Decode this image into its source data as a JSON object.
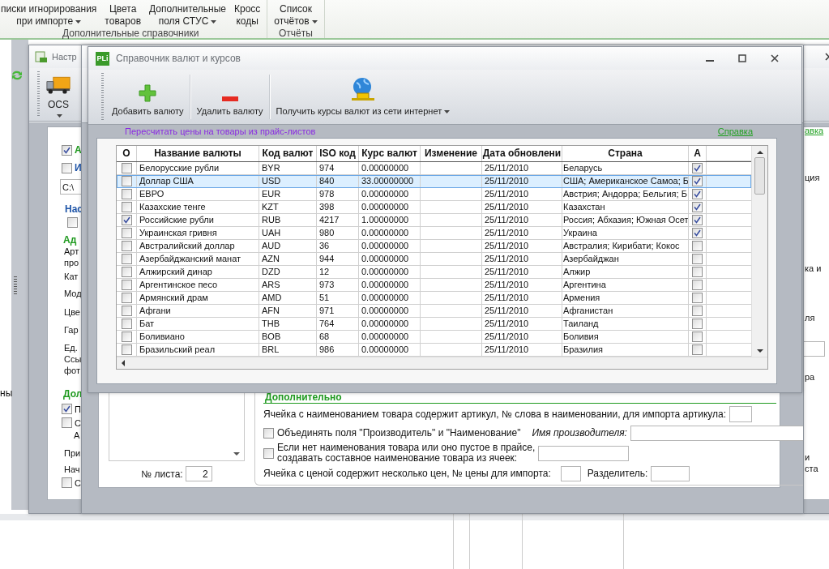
{
  "ribbon": {
    "groups": [
      {
        "label": "Дополнительные справочники",
        "buttons": [
          {
            "lines": [
              "писки игнорирования",
              "при импорте"
            ],
            "dropdown": true
          },
          {
            "lines": [
              "Цвета",
              "товаров"
            ],
            "dropdown": false
          },
          {
            "lines": [
              "Дополнительные",
              "поля СТУС"
            ],
            "dropdown": true
          },
          {
            "lines": [
              "Кросс",
              "коды"
            ],
            "dropdown": false
          }
        ]
      },
      {
        "label": "Отчёты",
        "buttons": [
          {
            "lines": [
              "Список",
              "отчётов"
            ],
            "dropdown": true
          }
        ]
      }
    ]
  },
  "side_text": "ны",
  "settings_window": {
    "title": "Настр",
    "toolbar_button": {
      "label": "OCS",
      "dropdown": true
    },
    "left_fragments": [
      {
        "kind": "checkbox",
        "text": "А",
        "checked": true,
        "color": "#1f9a1f"
      },
      {
        "kind": "checkbox",
        "text": "И",
        "checked": false,
        "color": "#1f55a8"
      },
      {
        "kind": "field",
        "value": "C:\\"
      },
      {
        "kind": "heading",
        "text": "Нас",
        "color": "#1f55a8"
      },
      {
        "kind": "checkbox",
        "checked": false
      },
      {
        "kind": "heading",
        "text": "Ад",
        "color": "#1f9a1f"
      },
      {
        "kind": "label",
        "text": "Арт"
      },
      {
        "kind": "label",
        "text": "про"
      },
      {
        "kind": "label",
        "text": "Кат"
      },
      {
        "kind": "label",
        "text": "Мод"
      },
      {
        "kind": "label",
        "text": "Цве"
      },
      {
        "kind": "label",
        "text": "Гар"
      },
      {
        "kind": "label",
        "text": "Ед."
      },
      {
        "kind": "label",
        "text": "Ссы"
      },
      {
        "kind": "label",
        "text": "фот"
      },
      {
        "kind": "heading",
        "text": "Дол",
        "color": "#1f9a1f"
      },
      {
        "kind": "checkbox",
        "text": "П",
        "checked": true
      },
      {
        "kind": "checkbox",
        "text": "С",
        "checked": false
      },
      {
        "kind": "label",
        "text": "А"
      },
      {
        "kind": "label",
        "text": "При"
      },
      {
        "kind": "label",
        "text": "Нач"
      },
      {
        "kind": "checkbox",
        "text": "С",
        "checked": false
      }
    ],
    "right_fragments": [
      {
        "kind": "link",
        "text": "авка"
      },
      {
        "kind": "label",
        "text": "ция"
      },
      {
        "kind": "label",
        "text": "ка и"
      },
      {
        "kind": "label",
        "text": "ля"
      },
      {
        "kind": "field"
      },
      {
        "kind": "label",
        "text": "ра"
      },
      {
        "kind": "label",
        "text": "и"
      },
      {
        "kind": "label",
        "text": "ста"
      }
    ]
  },
  "import_window": {
    "sheet_label": "№ листа:",
    "sheet_value": "2",
    "extra": {
      "heading": "Дополнительно",
      "article_label": "Ячейка с наименованием товара содержит артикул, № слова в наименовании, для импорта артикула:",
      "merge": {
        "label": "Объединять поля \"Производитель\" и \"Наименование\"",
        "checked": false
      },
      "maker_label": "Имя производителя:",
      "compose": {
        "lines": [
          "Если нет наименования товара или оно пустое в прайсе,",
          "создавать составное наименование товара из ячеек:"
        ],
        "checked": false
      },
      "price_label": "Ячейка с ценой содержит несколько цен, № цены для импорта:",
      "separator_label": "Разделитель:"
    }
  },
  "currency_dialog": {
    "logo": "PLi",
    "title": "Справочник валют и курсов",
    "toolbar": [
      {
        "label": "Добавить валюту",
        "kind": "add",
        "dropdown": false
      },
      {
        "label": "Удалить валюту",
        "kind": "remove",
        "dropdown": false
      },
      {
        "label": "Получить курсы валют из сети интернет",
        "kind": "download",
        "dropdown": true
      }
    ],
    "recalc_link": "Пересчитать цены на товары из прайс-листов",
    "help_link": "Справка",
    "table": {
      "columns": [
        "О",
        "Название валюты",
        "Код валют",
        "ISO код",
        "Курс валют",
        "Изменение",
        "Дата обновлени",
        "Страна",
        "А"
      ],
      "rows": [
        {
          "checked": false,
          "name": "Белорусские рубли",
          "code": "BYR",
          "iso": "974",
          "rate": "0.00000000",
          "date": "25/11/2010",
          "country": "Беларусь",
          "active": true,
          "selected": false
        },
        {
          "checked": false,
          "name": "Доллар США",
          "code": "USD",
          "iso": "840",
          "rate": "33.00000000",
          "date": "25/11/2010",
          "country": "США; Американское Самоа; Б",
          "active": true,
          "selected": true
        },
        {
          "checked": false,
          "name": "ЕВРО",
          "code": "EUR",
          "iso": "978",
          "rate": "0.00000000",
          "date": "25/11/2010",
          "country": "Австрия; Андорра; Бельгия; Б",
          "active": true,
          "selected": false
        },
        {
          "checked": false,
          "name": "Казахские тенге",
          "code": "KZT",
          "iso": "398",
          "rate": "0.00000000",
          "date": "25/11/2010",
          "country": "Казахстан",
          "active": true,
          "selected": false
        },
        {
          "checked": true,
          "name": "Российские рубли",
          "code": "RUB",
          "iso": "4217",
          "rate": "1.00000000",
          "date": "25/11/2010",
          "country": "Россия; Абхазия; Южная Осет",
          "active": true,
          "selected": false
        },
        {
          "checked": false,
          "name": "Украинская гривня",
          "code": "UAH",
          "iso": "980",
          "rate": "0.00000000",
          "date": "25/11/2010",
          "country": "Украина",
          "active": true,
          "selected": false
        },
        {
          "checked": false,
          "name": "Австралийский доллар",
          "code": "AUD",
          "iso": "36",
          "rate": "0.00000000",
          "date": "25/11/2010",
          "country": "Австралия; Кирибати; Кокос",
          "active": false,
          "selected": false
        },
        {
          "checked": false,
          "name": "Азербайджанский манат",
          "code": "AZN",
          "iso": "944",
          "rate": "0.00000000",
          "date": "25/11/2010",
          "country": "Азербайджан",
          "active": false,
          "selected": false
        },
        {
          "checked": false,
          "name": "Алжирский динар",
          "code": "DZD",
          "iso": "12",
          "rate": "0.00000000",
          "date": "25/11/2010",
          "country": "Алжир",
          "active": false,
          "selected": false
        },
        {
          "checked": false,
          "name": "Аргентинское песо",
          "code": "ARS",
          "iso": "973",
          "rate": "0.00000000",
          "date": "25/11/2010",
          "country": "Аргентина",
          "active": false,
          "selected": false
        },
        {
          "checked": false,
          "name": "Армянский драм",
          "code": "AMD",
          "iso": "51",
          "rate": "0.00000000",
          "date": "25/11/2010",
          "country": "Армения",
          "active": false,
          "selected": false
        },
        {
          "checked": false,
          "name": "Афгани",
          "code": "AFN",
          "iso": "971",
          "rate": "0.00000000",
          "date": "25/11/2010",
          "country": "Афганистан",
          "active": false,
          "selected": false
        },
        {
          "checked": false,
          "name": "Бат",
          "code": "THB",
          "iso": "764",
          "rate": "0.00000000",
          "date": "25/11/2010",
          "country": "Таиланд",
          "active": false,
          "selected": false
        },
        {
          "checked": false,
          "name": "Боливиано",
          "code": "BOB",
          "iso": "68",
          "rate": "0.00000000",
          "date": "25/11/2010",
          "country": "Боливия",
          "active": false,
          "selected": false
        },
        {
          "checked": false,
          "name": "Бразильский реал",
          "code": "BRL",
          "iso": "986",
          "rate": "0.00000000",
          "date": "25/11/2010",
          "country": "Бразилия",
          "active": false,
          "selected": false
        }
      ]
    }
  }
}
